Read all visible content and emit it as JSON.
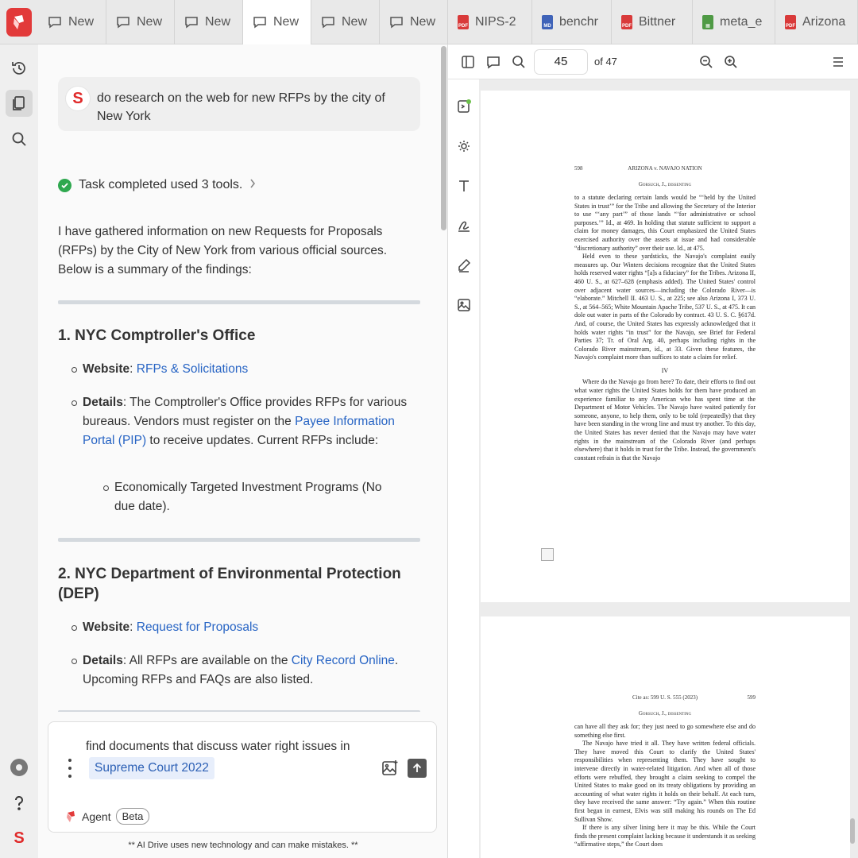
{
  "tabs": [
    {
      "label": "New",
      "icon": "chat-icon",
      "active": false
    },
    {
      "label": "New",
      "icon": "chat-icon",
      "active": false
    },
    {
      "label": "New",
      "icon": "chat-icon",
      "active": false
    },
    {
      "label": "New",
      "icon": "chat-icon",
      "active": true
    },
    {
      "label": "New",
      "icon": "chat-icon",
      "active": false
    },
    {
      "label": "New",
      "icon": "chat-icon",
      "active": false
    },
    {
      "label": "NIPS-2",
      "icon": "pdf-file-icon",
      "active": false
    },
    {
      "label": "benchr",
      "icon": "markdown-file-icon",
      "active": false
    },
    {
      "label": "Bittner",
      "icon": "pdf-file-icon",
      "active": false
    },
    {
      "label": "meta_e",
      "icon": "spreadsheet-file-icon",
      "active": false
    },
    {
      "label": "Arizona",
      "icon": "pdf-file-icon",
      "active": false
    }
  ],
  "chat": {
    "user_avatar": "S",
    "user_message": "do research on the web for new RFPs by the city of New York",
    "task_status": "Task completed used 3 tools.",
    "intro": "I have gathered information on new Requests for Proposals (RFPs) by the City of New York from various official sources. Below is a summary of the findings:",
    "section1": {
      "title": "1. NYC Comptroller's Office",
      "website_label": "Website",
      "website_link": "RFPs & Solicitations",
      "details_label": "Details",
      "details_text_a": ": The Comptroller's Office provides RFPs for various bureaus. Vendors must register on the ",
      "details_link": "Payee Information Portal (PIP)",
      "details_text_b": " to receive updates. Current RFPs include:",
      "sub_item": "Economically Targeted Investment Programs (No due date)."
    },
    "section2": {
      "title": "2. NYC Department of Environmental Protection (DEP)",
      "website_label": "Website",
      "website_link": "Request for Proposals",
      "details_label": "Details",
      "details_text_a": ": All RFPs are available on the ",
      "details_link": "City Record Online",
      "details_text_b": ". Upcoming RFPs and FAQs are also listed."
    }
  },
  "input": {
    "text": "find documents that discuss water right issues in",
    "chip": "Supreme Court 2022",
    "agent_label": "Agent",
    "beta_label": "Beta",
    "disclaimer": "** AI Drive uses new technology and can make mistakes. **"
  },
  "rail_bottom_avatar": "S",
  "pdf": {
    "current_page": "45",
    "page_total": "of 47",
    "page1": {
      "number": "598",
      "running_head": "ARIZONA v. NAVAJO NATION",
      "author_line": "Gorsuch, J., dissenting",
      "para1": "to a statute declaring certain lands would be “‘held by the United States in trust’” for the Tribe and allowing the Secretary of the Interior to use “‘any part’” of those lands “‘for administrative or school purposes.’” Id., at 469. In holding that statute sufficient to support a claim for money damages, this Court emphasized the United States exercised authority over the assets at issue and had considerable “discretionary authority” over their use. Id., at 475.",
      "para2": "Held even to these yardsticks, the Navajo's complaint easily measures up. Our Winters decisions recognize that the United States holds reserved water rights “[a]s a fiduciary” for the Tribes. Arizona II, 460 U. S., at 627–628 (emphasis added). The United States' control over adjacent water sources—including the Colorado River—is “elaborate.” Mitchell II. 463 U. S., at 225; see also Arizona I, 373 U. S., at 564–565; White Mountain Apache Tribe, 537 U. S., at 475. It can dole out water in parts of the Colorado by contract. 43 U. S. C. §617d. And, of course, the United States has expressly acknowledged that it holds water rights “in trust” for the Navajo, see Brief for Federal Parties 37; Tr. of Oral Arg. 40, perhaps including rights in the Colorado River mainstream, id., at 33. Given these features, the Navajo's complaint more than suffices to state a claim for relief.",
      "section_mark": "IV",
      "para3": "Where do the Navajo go from here? To date, their efforts to find out what water rights the United States holds for them have produced an experience familiar to any American who has spent time at the Department of Motor Vehicles. The Navajo have waited patiently for someone, anyone, to help them, only to be told (repeatedly) that they have been standing in the wrong line and must try another. To this day, the United States has never denied that the Navajo may have water rights in the mainstream of the Colorado River (and perhaps elsewhere) that it holds in trust for the Tribe. Instead, the government's constant refrain is that the Navajo"
    },
    "page2": {
      "cite": "Cite as: 599 U. S. 555 (2023)",
      "number": "599",
      "author_line": "Gorsuch, J., dissenting",
      "para1": "can have all they ask for; they just need to go somewhere else and do something else first.",
      "para2": "The Navajo have tried it all. They have written federal officials. They have moved this Court to clarify the United States' responsibilities when representing them. They have sought to intervene directly in water-related litigation. And when all of those efforts were rebuffed, they brought a claim seeking to compel the United States to make good on its treaty obligations by providing an accounting of what water rights it holds on their behalf. At each turn, they have received the same answer: “Try again.” When this routine first began in earnest, Elvis was still making his rounds on The Ed Sullivan Show.",
      "para3": "If there is any silver lining here it may be this. While the Court finds the present complaint lacking because it understands it as seeking “affirmative steps,” the Court does"
    }
  },
  "colors": {
    "brand_red": "#e23a3a",
    "link_blue": "#2764c4",
    "success_green": "#2fa84f"
  }
}
